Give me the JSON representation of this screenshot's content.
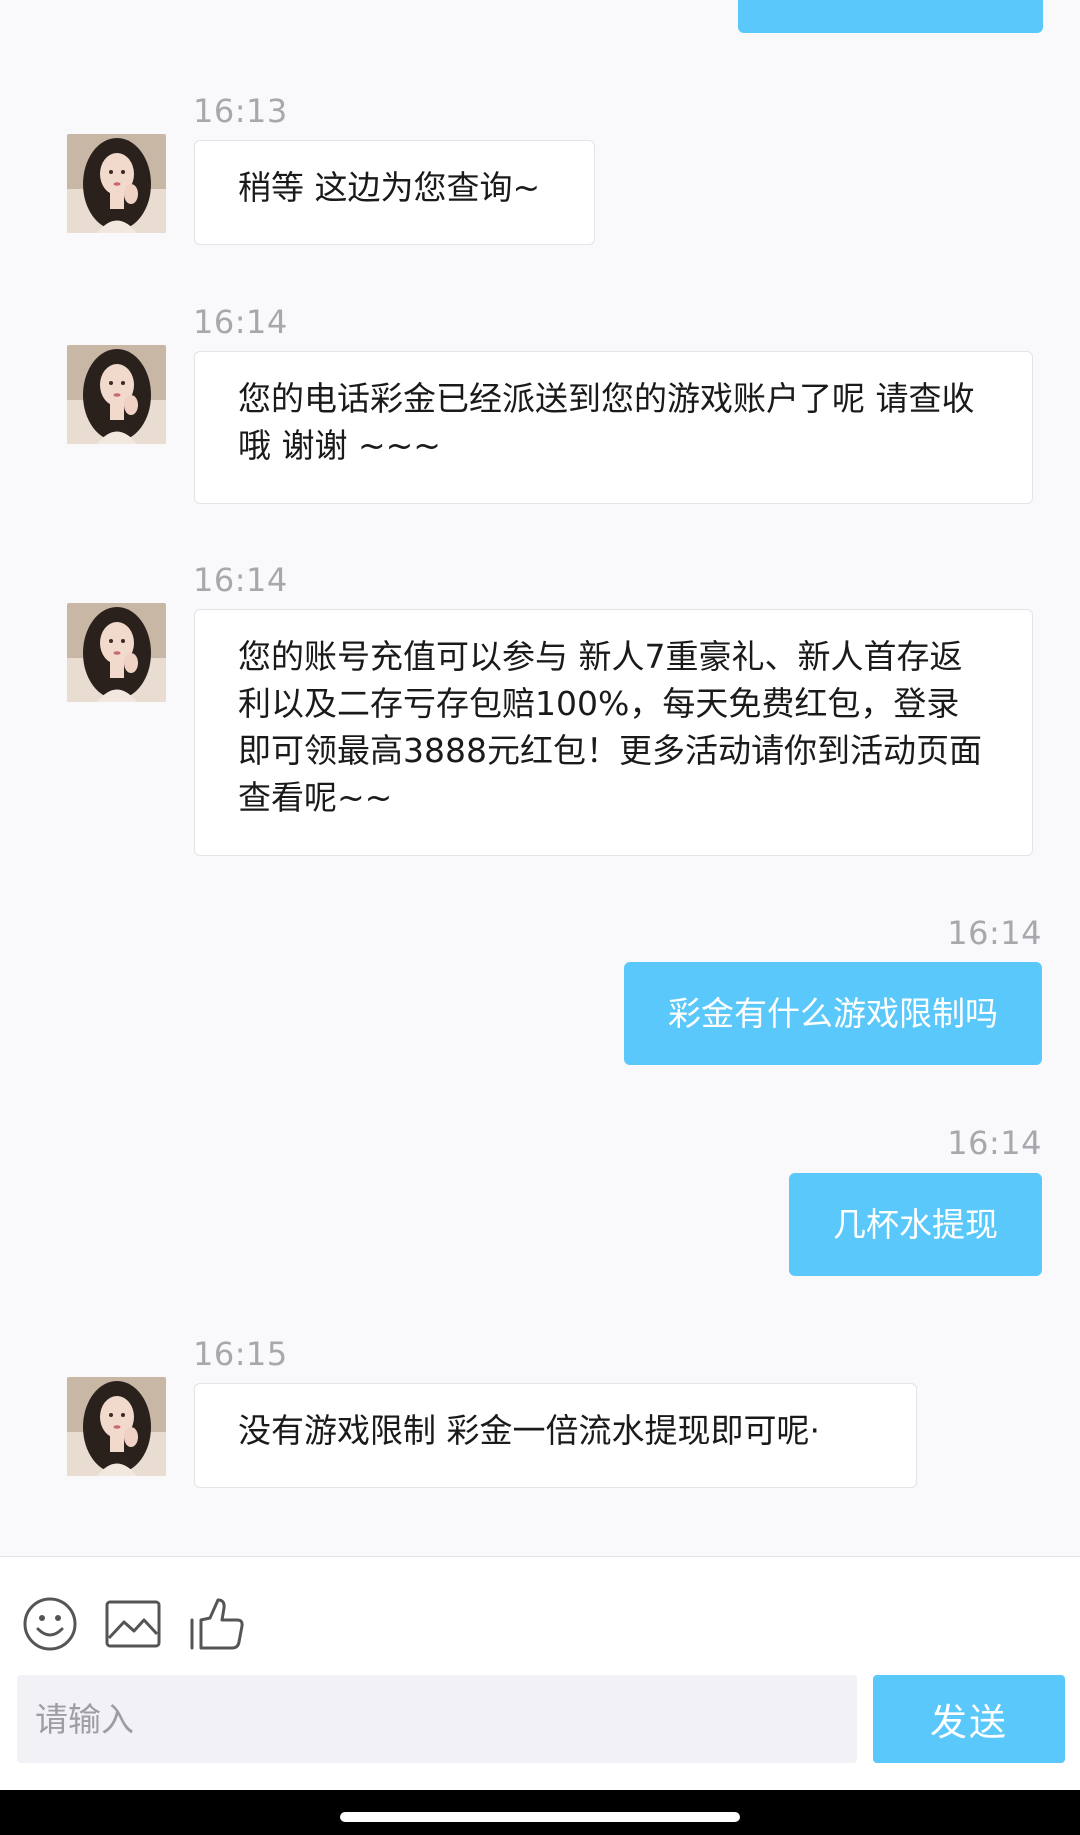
{
  "messages": [
    {
      "id": "m1",
      "time": "16:13",
      "sender": "agent",
      "text": "稍等 这边为您查询~"
    },
    {
      "id": "m2",
      "time": "16:14",
      "sender": "agent",
      "text": "您的电话彩金已经派送到您的游戏账户了呢 请查收哦 谢谢 ~~~"
    },
    {
      "id": "m3",
      "time": "16:14",
      "sender": "agent",
      "text": "您的账号充值可以参与 新人7重豪礼、新人首存返利以及二存亏存包赔100%，每天免费红包，登录即可领最高3888元红包！更多活动请你到活动页面查看呢~~"
    },
    {
      "id": "m4",
      "time": "16:14",
      "sender": "user",
      "text": "彩金有什么游戏限制吗"
    },
    {
      "id": "m5",
      "time": "16:14",
      "sender": "user",
      "text": "几杯水提现"
    },
    {
      "id": "m6",
      "time": "16:15",
      "sender": "agent",
      "text": "没有游戏限制 彩金一倍流水提现即可呢·"
    }
  ],
  "composer": {
    "placeholder": "请输入",
    "send_label": "发送",
    "tools": [
      "emoji-icon",
      "image-icon",
      "thumbs-up-icon"
    ]
  },
  "colors": {
    "accent": "#5ac8fa",
    "background": "#f9f9fb",
    "agent_bubble": "#ffffff",
    "timestamp": "#a7a7ad"
  }
}
